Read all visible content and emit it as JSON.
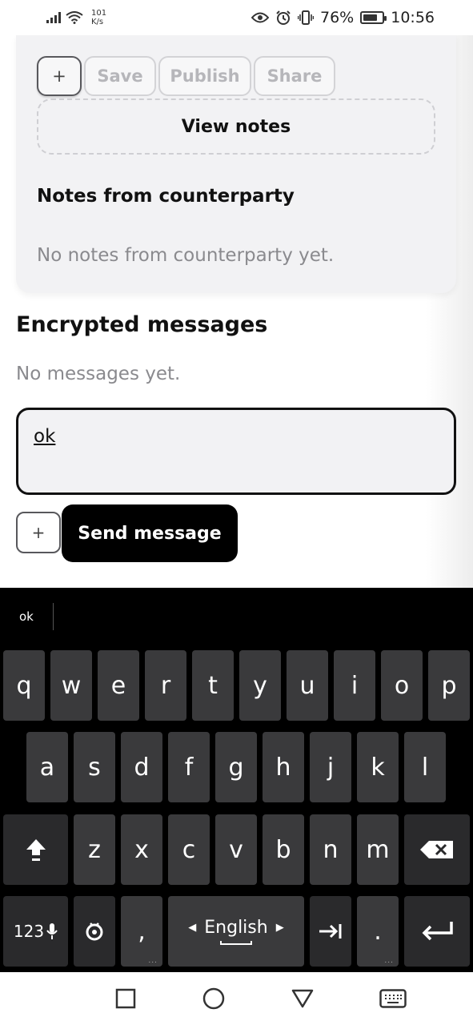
{
  "status_bar": {
    "net_speed_value": "101",
    "net_speed_unit": "K/s",
    "battery": "76%",
    "battery_level": 0.76,
    "time": "10:56"
  },
  "card": {
    "plus_label": "+",
    "save_label": "Save",
    "publish_label": "Publish",
    "share_label": "Share",
    "view_notes_label": "View notes",
    "counterparty_heading": "Notes from counterparty",
    "counterparty_empty": "No notes from counterparty yet."
  },
  "messages": {
    "title": "Encrypted messages",
    "empty": "No messages yet.",
    "input_value": "ok",
    "plus_label": "+",
    "send_label": "Send message"
  },
  "keyboard": {
    "suggestion": "ok",
    "row1": [
      "q",
      "w",
      "e",
      "r",
      "t",
      "y",
      "u",
      "i",
      "o",
      "p"
    ],
    "row2": [
      "a",
      "s",
      "d",
      "f",
      "g",
      "h",
      "j",
      "k",
      "l"
    ],
    "row3": [
      "z",
      "x",
      "c",
      "v",
      "b",
      "n",
      "m"
    ],
    "numbers_label": "123",
    "comma_label": ",",
    "space_label": "English",
    "period_label": "."
  },
  "colors": {
    "accent_button": "#000000",
    "card_bg": "#f2f2f4",
    "keyboard_bg": "#000000",
    "key_bg": "#3a3a3c"
  }
}
